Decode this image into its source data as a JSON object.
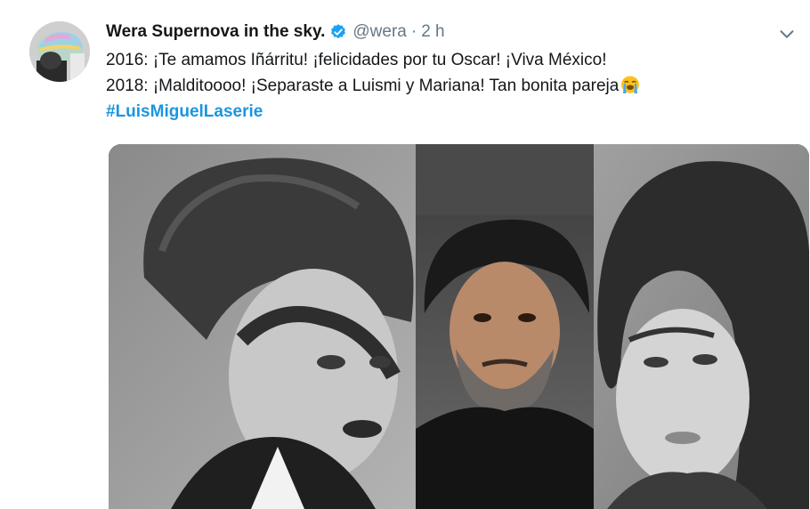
{
  "tweet": {
    "author_name": "Wera Supernova in the sky.",
    "handle": "@wera",
    "separator": "·",
    "time": "2 h",
    "lines": [
      "2016: ¡Te amamos Iñárritu! ¡felicidades por tu Oscar! ¡Viva México!",
      "2018: ¡Malditoooo! ¡Separaste a Luismi y Mariana! Tan bonita pareja"
    ],
    "hashtag": "#LuisMiguelLaserie",
    "icons": {
      "verified": "verified-badge-icon",
      "emoji": "loudly-crying-face-emoji",
      "menu": "chevron-down-icon"
    },
    "colors": {
      "link": "#1b95e0",
      "secondary_text": "#657786",
      "verified": "#1da1f2"
    }
  },
  "media": {
    "panels": [
      "black-and-white portrait of young man",
      "color portrait of bearded man",
      "black-and-white portrait of woman"
    ]
  }
}
